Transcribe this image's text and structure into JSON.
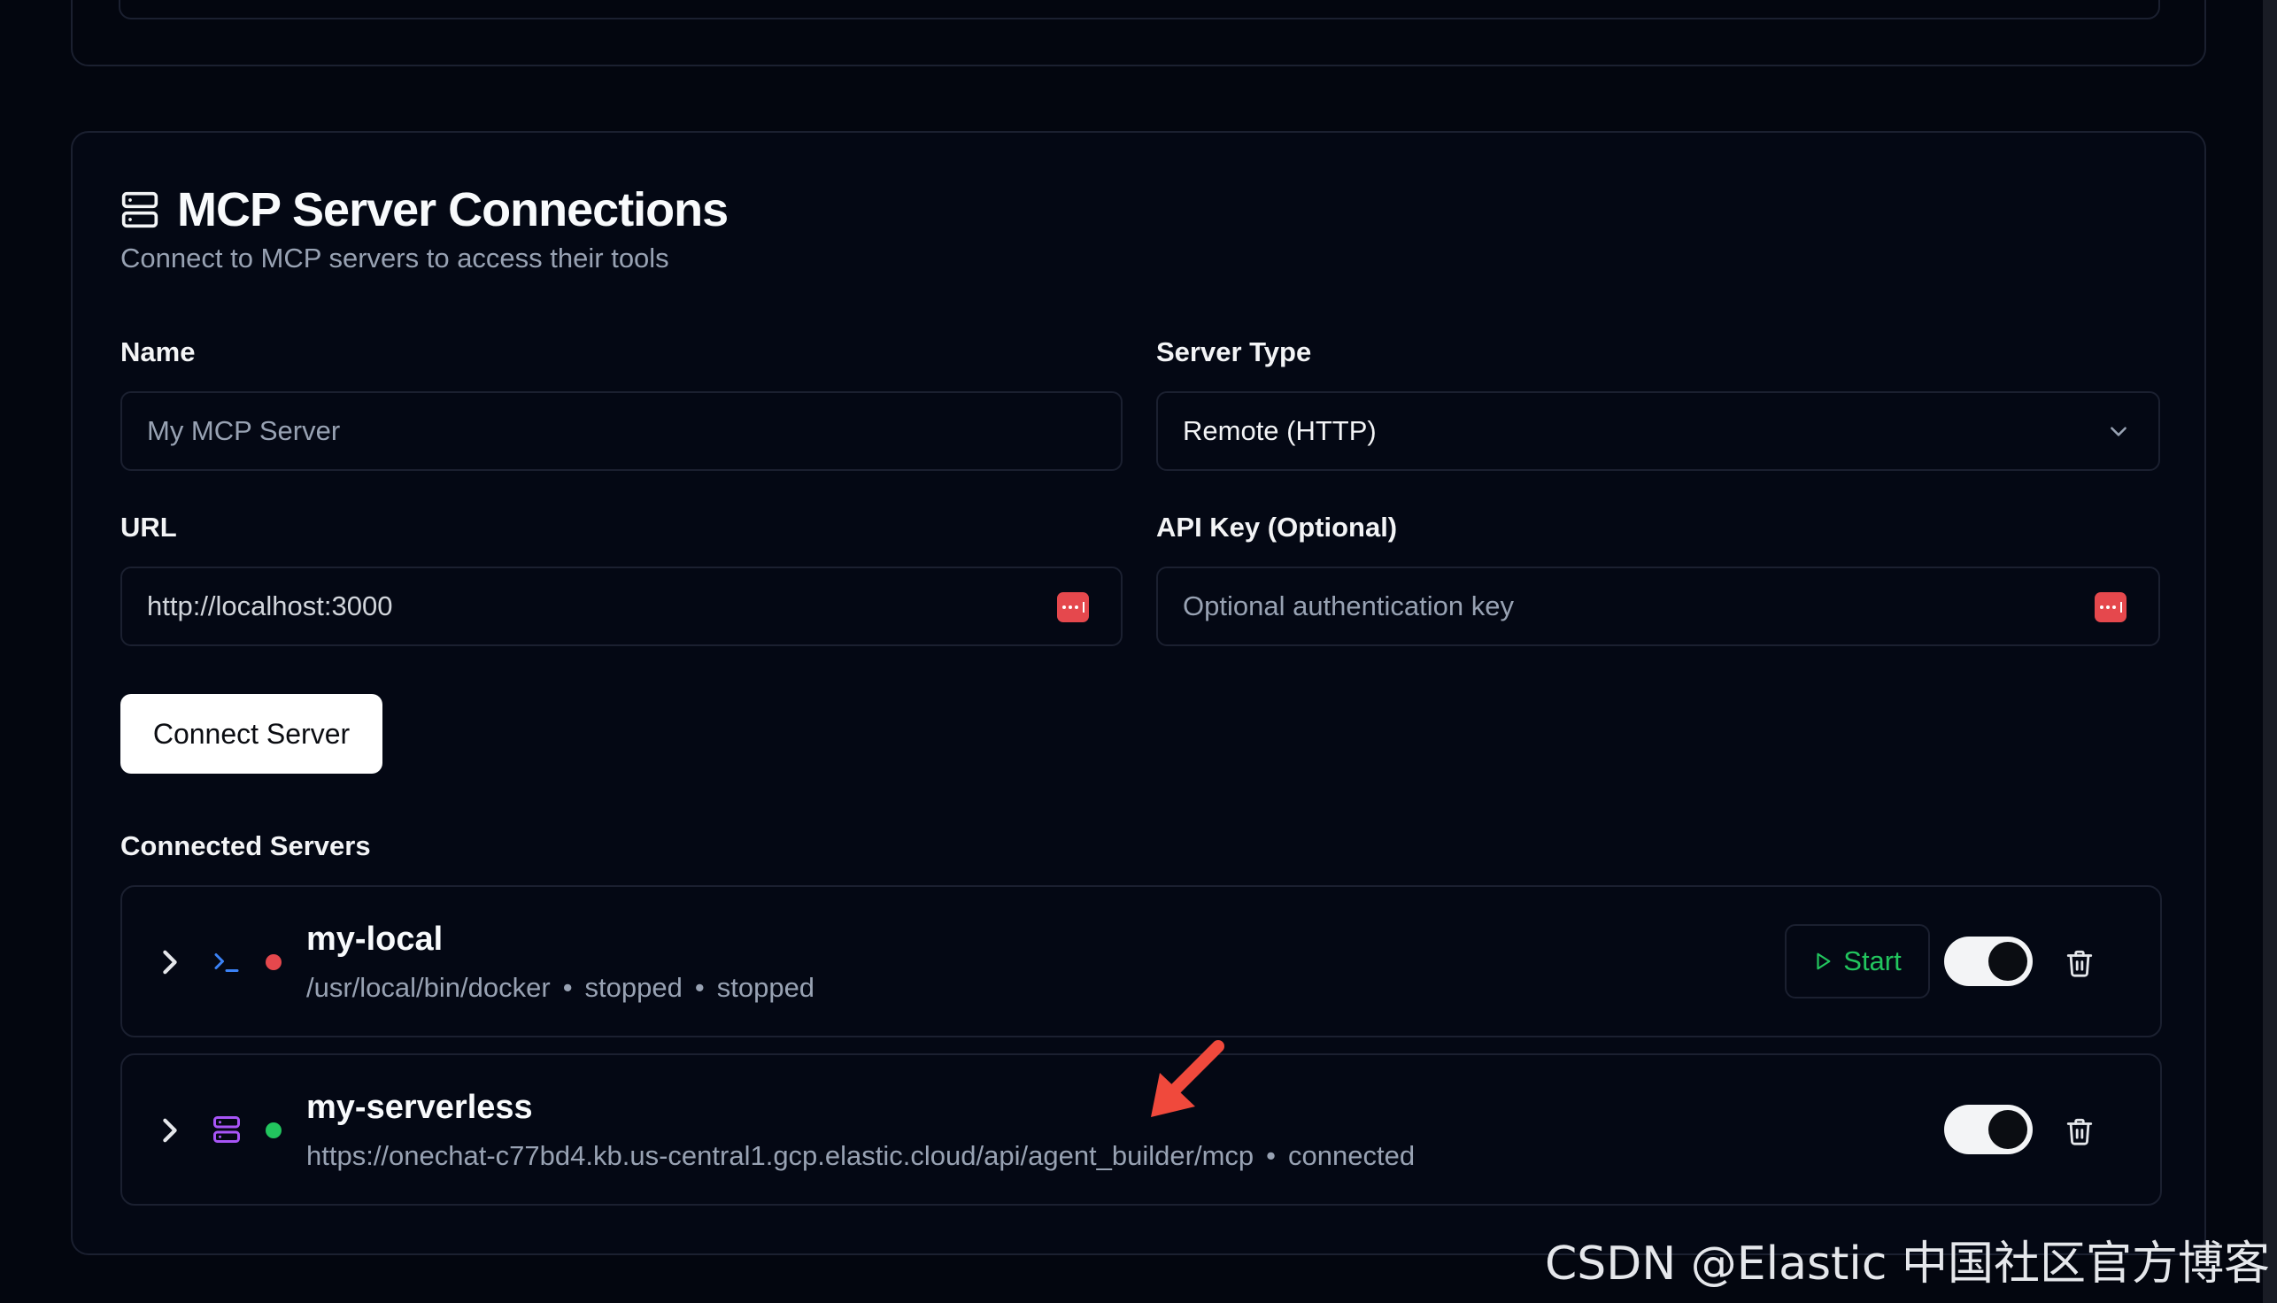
{
  "section": {
    "title": "MCP Server Connections",
    "subtitle": "Connect to MCP servers to access their tools"
  },
  "form": {
    "name_label": "Name",
    "name_placeholder": "My MCP Server",
    "server_type_label": "Server Type",
    "server_type_value": "Remote (HTTP)",
    "url_label": "URL",
    "url_value": "http://localhost:3000",
    "api_key_label": "API Key (Optional)",
    "api_key_placeholder": "Optional authentication key",
    "connect_button": "Connect Server"
  },
  "connected": {
    "label": "Connected Servers",
    "servers": [
      {
        "name": "my-local",
        "meta_1": "/usr/local/bin/docker",
        "meta_2": "stopped",
        "meta_3": "stopped",
        "status_color": "#e5484d",
        "type_icon": "terminal-icon",
        "start_label": "Start",
        "enabled": true
      },
      {
        "name": "my-serverless",
        "meta_1": "https://onechat-c77bd4.kb.us-central1.gcp.elastic.cloud/api/agent_builder/mcp",
        "meta_2": "connected",
        "status_color": "#22c55e",
        "type_icon": "server-icon",
        "enabled": true
      }
    ]
  },
  "separator": "•",
  "watermark": "CSDN @Elastic 中国社区官方博客",
  "colors": {
    "background": "#03060f",
    "border": "#1b2030",
    "muted_text": "#98a2b3",
    "success": "#22c55e",
    "danger": "#e5484d",
    "accent_purple": "#a855f7",
    "accent_blue": "#3b82f6",
    "annotation": "#f0493c"
  }
}
